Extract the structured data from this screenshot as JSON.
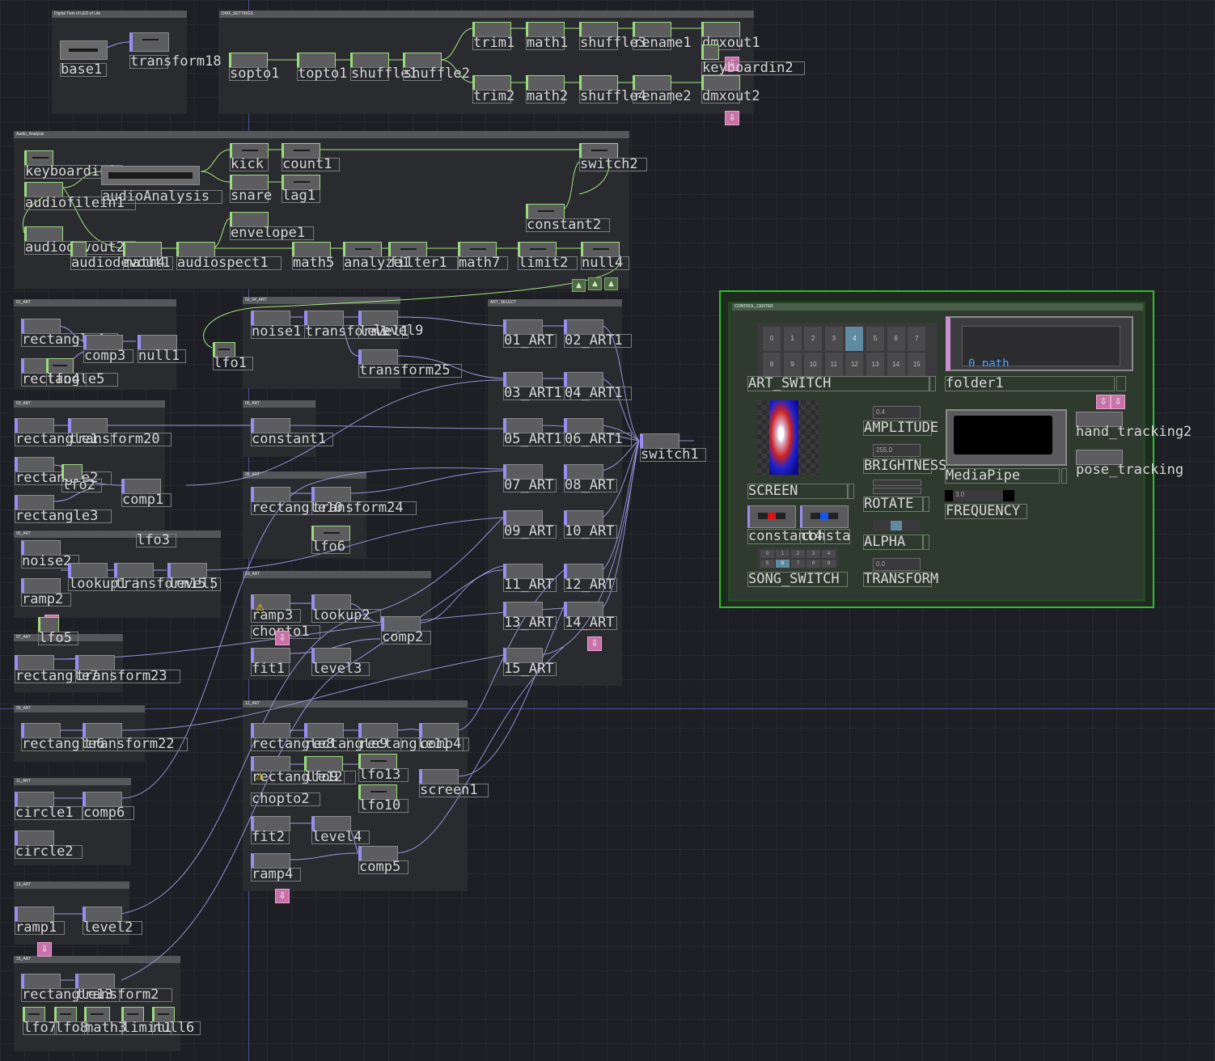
{
  "panels": [
    {
      "id": "p-digital",
      "title": "Digital Twin of LED of Life"
    },
    {
      "id": "p-dmx",
      "title": "DMX_SETTINGS"
    },
    {
      "id": "p-audio",
      "title": "Audio_Analysis"
    },
    {
      "id": "p-01",
      "title": "01_ART"
    },
    {
      "id": "p-0204",
      "title": "02_04_ART"
    },
    {
      "id": "p-artselect",
      "title": "ART_SELECT"
    },
    {
      "id": "p-03",
      "title": "03_ART"
    },
    {
      "id": "p-06",
      "title": "06_ART"
    },
    {
      "id": "p-08",
      "title": "08_ART"
    },
    {
      "id": "p-05",
      "title": "05_ART"
    },
    {
      "id": "p-10",
      "title": "10_ART"
    },
    {
      "id": "p-07",
      "title": "07_ART"
    },
    {
      "id": "p-09",
      "title": "09_ART"
    },
    {
      "id": "p-12",
      "title": "12_ART"
    },
    {
      "id": "p-11",
      "title": "11_ART"
    },
    {
      "id": "p-13",
      "title": "13_ART"
    },
    {
      "id": "p-15",
      "title": "15_ART"
    }
  ],
  "operators": [
    {
      "name": "base1",
      "kind": "comp",
      "tile": "Bus"
    },
    {
      "name": "transform18",
      "kind": "top"
    },
    {
      "name": "sopto1",
      "kind": "chop"
    },
    {
      "name": "topto1",
      "kind": "chop"
    },
    {
      "name": "shuffle1",
      "kind": "chop"
    },
    {
      "name": "shuffle2",
      "kind": "chop"
    },
    {
      "name": "trim1",
      "kind": "chop"
    },
    {
      "name": "math1",
      "kind": "chop"
    },
    {
      "name": "shuffle3",
      "kind": "chop"
    },
    {
      "name": "rename1",
      "kind": "chop"
    },
    {
      "name": "dmxout1",
      "kind": "chop"
    },
    {
      "name": "keyboardin2",
      "kind": "chop"
    },
    {
      "name": "trim2",
      "kind": "chop"
    },
    {
      "name": "math2",
      "kind": "chop"
    },
    {
      "name": "shuffle4",
      "kind": "chop"
    },
    {
      "name": "rename2",
      "kind": "chop"
    },
    {
      "name": "dmxout2",
      "kind": "chop"
    },
    {
      "name": "keyboardin1",
      "kind": "chop"
    },
    {
      "name": "audioAnalysis",
      "kind": "comp",
      "tile": "Ctn"
    },
    {
      "name": "kick",
      "kind": "chop"
    },
    {
      "name": "count1",
      "kind": "chop"
    },
    {
      "name": "switch2",
      "kind": "chop"
    },
    {
      "name": "snare",
      "kind": "chop"
    },
    {
      "name": "lag1",
      "kind": "chop"
    },
    {
      "name": "audiofilein1",
      "kind": "chop"
    },
    {
      "name": "constant2",
      "kind": "chop"
    },
    {
      "name": "envelope1",
      "kind": "chop"
    },
    {
      "name": "audiodevout2",
      "kind": "chop"
    },
    {
      "name": "audiodevout1",
      "kind": "chop"
    },
    {
      "name": "math4",
      "kind": "chop"
    },
    {
      "name": "audiospect1",
      "kind": "chop"
    },
    {
      "name": "math5",
      "kind": "chop"
    },
    {
      "name": "analyze1",
      "kind": "chop"
    },
    {
      "name": "filter1",
      "kind": "chop"
    },
    {
      "name": "math7",
      "kind": "chop"
    },
    {
      "name": "limit2",
      "kind": "chop"
    },
    {
      "name": "null4",
      "kind": "chop"
    },
    {
      "name": "rectangle4",
      "kind": "top"
    },
    {
      "name": "comp3",
      "kind": "top"
    },
    {
      "name": "null1",
      "kind": "top"
    },
    {
      "name": "lfo1",
      "kind": "chop"
    },
    {
      "name": "rectangle5",
      "kind": "top"
    },
    {
      "name": "lfo4",
      "kind": "chop"
    },
    {
      "name": "noise1",
      "kind": "top"
    },
    {
      "name": "transform1",
      "kind": "top"
    },
    {
      "name": "level1",
      "kind": "top"
    },
    {
      "name": "level9",
      "kind": "top"
    },
    {
      "name": "transform25",
      "kind": "top"
    },
    {
      "name": "01_ART",
      "kind": "top"
    },
    {
      "name": "02_ART1",
      "kind": "top"
    },
    {
      "name": "03_ART1",
      "kind": "top"
    },
    {
      "name": "04_ART1",
      "kind": "top"
    },
    {
      "name": "05_ART1",
      "kind": "top"
    },
    {
      "name": "06_ART1",
      "kind": "top"
    },
    {
      "name": "07_ART",
      "kind": "top"
    },
    {
      "name": "08_ART",
      "kind": "top"
    },
    {
      "name": "09_ART",
      "kind": "top"
    },
    {
      "name": "10_ART",
      "kind": "top"
    },
    {
      "name": "11_ART",
      "kind": "top"
    },
    {
      "name": "12_ART",
      "kind": "top"
    },
    {
      "name": "13_ART",
      "kind": "top"
    },
    {
      "name": "14_ART",
      "kind": "top"
    },
    {
      "name": "15_ART",
      "kind": "top"
    },
    {
      "name": "rectangle1",
      "kind": "top"
    },
    {
      "name": "transform20",
      "kind": "top"
    },
    {
      "name": "constant1",
      "kind": "top"
    },
    {
      "name": "rectangle2",
      "kind": "top"
    },
    {
      "name": "lfo2",
      "kind": "chop"
    },
    {
      "name": "comp1",
      "kind": "top"
    },
    {
      "name": "rectangle3",
      "kind": "top"
    },
    {
      "name": "rectangle10",
      "kind": "top"
    },
    {
      "name": "transform24",
      "kind": "top"
    },
    {
      "name": "lfo6",
      "kind": "chop"
    },
    {
      "name": "lfo3",
      "kind": "chop"
    },
    {
      "name": "noise2",
      "kind": "top"
    },
    {
      "name": "lookup1",
      "kind": "top"
    },
    {
      "name": "transform15",
      "kind": "top"
    },
    {
      "name": "level5",
      "kind": "top"
    },
    {
      "name": "ramp2",
      "kind": "top"
    },
    {
      "name": "ramp3",
      "kind": "top"
    },
    {
      "name": "lookup2",
      "kind": "top"
    },
    {
      "name": "chopto1",
      "kind": "top"
    },
    {
      "name": "comp2",
      "kind": "top"
    },
    {
      "name": "lfo5",
      "kind": "chop"
    },
    {
      "name": "rectangle7",
      "kind": "top"
    },
    {
      "name": "transform23",
      "kind": "top"
    },
    {
      "name": "fit1",
      "kind": "top"
    },
    {
      "name": "level3",
      "kind": "top"
    },
    {
      "name": "switch1",
      "kind": "top"
    },
    {
      "name": "rectangle6",
      "kind": "top"
    },
    {
      "name": "transform22",
      "kind": "top"
    },
    {
      "name": "rectangle8",
      "kind": "top"
    },
    {
      "name": "rectangle9",
      "kind": "top"
    },
    {
      "name": "rectangle11",
      "kind": "top"
    },
    {
      "name": "comp4",
      "kind": "top"
    },
    {
      "name": "rectangle12",
      "kind": "top"
    },
    {
      "name": "lfo9",
      "kind": "chop"
    },
    {
      "name": "lfo13",
      "kind": "chop"
    },
    {
      "name": "chopto2",
      "kind": "top"
    },
    {
      "name": "lfo10",
      "kind": "chop"
    },
    {
      "name": "screen1",
      "kind": "top"
    },
    {
      "name": "circle1",
      "kind": "top"
    },
    {
      "name": "comp6",
      "kind": "top"
    },
    {
      "name": "fit2",
      "kind": "top"
    },
    {
      "name": "level4",
      "kind": "top"
    },
    {
      "name": "circle2",
      "kind": "top"
    },
    {
      "name": "comp5",
      "kind": "top"
    },
    {
      "name": "ramp4",
      "kind": "top"
    },
    {
      "name": "ramp1",
      "kind": "top"
    },
    {
      "name": "level2",
      "kind": "top"
    },
    {
      "name": "rectangle13",
      "kind": "top"
    },
    {
      "name": "transform2",
      "kind": "top"
    },
    {
      "name": "lfo7",
      "kind": "chop"
    },
    {
      "name": "lfo8",
      "kind": "chop"
    },
    {
      "name": "math3",
      "kind": "chop"
    },
    {
      "name": "limit1",
      "kind": "chop"
    },
    {
      "name": "null6",
      "kind": "chop"
    }
  ],
  "control_center": {
    "title": "CONTROL_CENTER",
    "art_switch_label": "ART_SWITCH",
    "art_switch_buttons": [
      "0",
      "1",
      "2",
      "3",
      "4",
      "5",
      "6",
      "7",
      "8",
      "9",
      "10",
      "11",
      "12",
      "13",
      "14",
      "15"
    ],
    "art_switch_selected": "4",
    "folder_label": "folder1",
    "folder_text": "0 path",
    "screen_label": "SCREEN",
    "amplitude_label": "AMPLITUDE",
    "amplitude_value": "0.4",
    "brightness_label": "BRIGHTNESS",
    "brightness_value": "255.0",
    "rotate_label": "ROTATE",
    "mediapipe_label": "MediaPipe",
    "hand_tracking_label": "hand_tracking2",
    "pose_tracking_label": "pose_tracking",
    "frequency_label": "FREQUENCY",
    "frequency_value": "3.0",
    "constant_a_label": "constant4",
    "constant_b_label": "constant5",
    "alpha_label": "ALPHA",
    "song_switch_label": "SONG_SWITCH",
    "song_switch_buttons": [
      "0",
      "1",
      "2",
      "3",
      "4",
      "5",
      "6",
      "7",
      "8",
      "9"
    ],
    "song_switch_selected": "6",
    "transform_label": "TRANSFORM",
    "transform_value": "0.0"
  },
  "colors": {
    "background": "#1d1f24",
    "chop_accent": "#9adb7c",
    "top_accent": "#9a8cf0",
    "wire_top": "#a59ae6",
    "wire_chop": "#a3e67d",
    "control_border": "#29c229",
    "warning": "#ffd400",
    "export": "#c872a7"
  }
}
